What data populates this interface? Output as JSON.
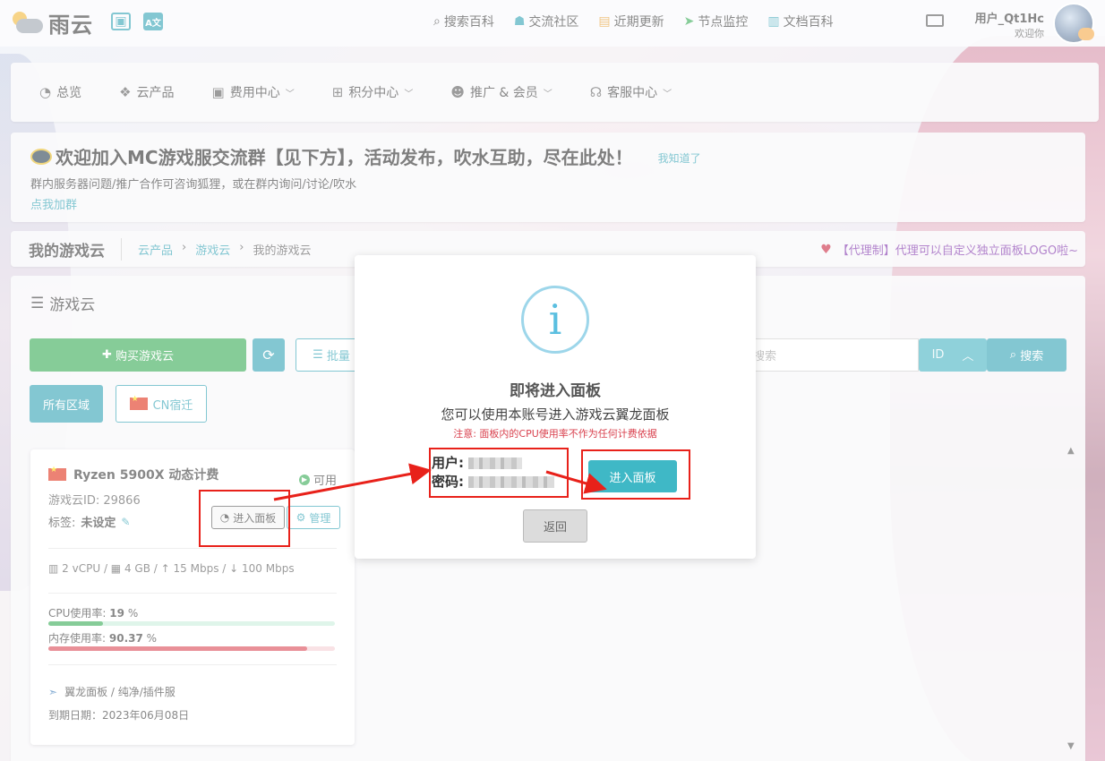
{
  "brand": {
    "name": "雨云"
  },
  "topnav": [
    {
      "icon": "search-icon",
      "label": "搜索百科"
    },
    {
      "icon": "qq-icon",
      "label": "交流社区"
    },
    {
      "icon": "news-icon",
      "label": "近期更新"
    },
    {
      "icon": "send-icon",
      "label": "节点监控"
    },
    {
      "icon": "book-icon",
      "label": "文档百科"
    }
  ],
  "user": {
    "name": "用户_Qt1Hc",
    "greeting": "欢迎你"
  },
  "menu": [
    {
      "label": "总览",
      "dropdown": false
    },
    {
      "label": "云产品",
      "dropdown": false
    },
    {
      "label": "费用中心",
      "dropdown": true
    },
    {
      "label": "积分中心",
      "dropdown": true
    },
    {
      "label": "推广 & 会员",
      "dropdown": true
    },
    {
      "label": "客服中心",
      "dropdown": true
    }
  ],
  "notice": {
    "headline": "欢迎加入MC游戏服交流群【见下方】，活动发布，吹水互助，尽在此处！",
    "dismiss": "我知道了",
    "sub": "群内服务器问题/推广合作可咨询狐狸，或在群内询问/讨论/吹水",
    "join": "点我加群"
  },
  "breadcrumb": {
    "title": "我的游戏云",
    "items": [
      "云产品",
      "游戏云",
      "我的游戏云"
    ],
    "promo": "【代理制】代理可以自定义独立面板LOGO啦~"
  },
  "content": {
    "section_title": "游戏云",
    "buy_label": "购买游戏云",
    "batch_label": "批量",
    "search_placeholder": "搜索",
    "id_label": "ID",
    "search_button": "搜索",
    "zone_all": "所有区域",
    "zone_cn": "CN宿迁"
  },
  "card": {
    "name": "Ryzen 5900X 动态计费",
    "status": "可用",
    "id_line": "游戏云ID: 29866",
    "tag_label": "标签:",
    "tag_value": "未设定",
    "enter_label": "进入面板",
    "manage_label": "管理",
    "cpu": "2 vCPU",
    "ram": "4 GB",
    "up": "15 Mbps",
    "down": "100 Mbps",
    "cpu_usage_label": "CPU使用率:",
    "cpu_usage_value": "19",
    "cpu_usage_pct": 19,
    "mem_usage_label": "内存使用率:",
    "mem_usage_value": "90.37",
    "mem_usage_pct": 90.37,
    "pct_unit": "%",
    "panel_type": "翼龙面板 / 纯净/插件服",
    "expire": "到期日期：2023年06月08日"
  },
  "modal": {
    "title": "即将进入面板",
    "desc": "您可以使用本账号进入游戏云翼龙面板",
    "note": "注意: 面板内的CPU使用率不作为任何计费依据",
    "user_label": "用户:",
    "pass_label": "密码:",
    "go_button": "进入面板",
    "back_button": "返回"
  },
  "colors": {
    "accent": "#2a9fb2",
    "success": "#2fa84f",
    "danger": "#d9414e",
    "annotation": "#e8211a"
  }
}
